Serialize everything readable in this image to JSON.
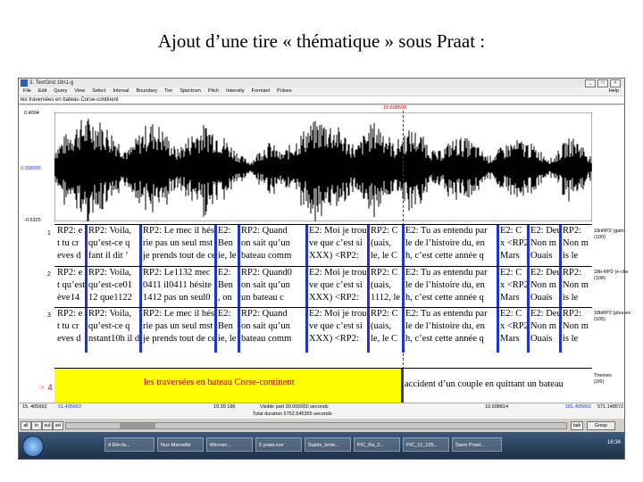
{
  "slide": {
    "title": "Ajout d’une tire « thématique » sous Praat :"
  },
  "window": {
    "title": "3. TextGrid 18n1-g",
    "controls": [
      "_",
      "□",
      "×"
    ],
    "menu": [
      "File",
      "Edit",
      "Query",
      "View",
      "Select",
      "Interval",
      "Boundary",
      "Tier",
      "Spectrum",
      "Pitch",
      "Intensity",
      "Formant",
      "Pulses"
    ],
    "help": "Help",
    "text_field": "les traversées en bateau Corse-continent"
  },
  "waveform": {
    "cursor_time": "10.608598",
    "y_top": "0.4004",
    "y_mid": "0.008306",
    "y_bottom": "-0.5325"
  },
  "tiers": [
    {
      "number": "1",
      "name": "18nRP2 (gam\n(100)",
      "intervals": [
        [
          "RP2: e\nt tu cr\neves d",
          "RP2: Voila,\nqu’est-ce q\nfant il dit ’",
          "RP2: Le mec il hés\nrie pas un seul mst\nje prends tout de ce",
          "E2:\nBen\nie, le",
          "RP2: Quand\non sait qu’un\nbateau comm",
          "E2: Moi je trou\nve que c’est si\nXXX) <RP2: ",
          "RP2: C\n(uais,\nle, le C",
          "E2: Tu as entendu par\nle de l’histoire du, en\nh, c’est cette année q",
          "E2: C\nx <RP2\nMars",
          "E2: Deu\nNon m\nOuais",
          "RP2:\nNon m\nis le"
        ]
      ]
    },
    {
      "number": "2",
      "name": "18b-RP2 (e-chv\n(108)",
      "intervals": [
        [
          "RP2: e\nt qu’est\nève14",
          "RP2: Voila,\nqu’est-ce01\n12 que1122",
          "RP2: Le1132 mec\n0411 il0411 hésite\n1412 pas un seul0",
          "E2:\nBen\n, on",
          "RP2: Quand0\non sait qu’un\nun bateau c",
          "E2: Moi je trou\nve que c’est si\nXXX) <RP2: ",
          "RP2: C\n(uais,\n1112, le",
          "E2: Tu as entendu par\nle de l’histoire du, en\nh, c’est cette année q",
          "E2: C\nx <RP2\nMars",
          "E2: Deu\nNon m\nOuais",
          "RP2:\nNon m\nis le"
        ]
      ]
    },
    {
      "number": "3",
      "name": "18bRP2 (plus-ex\n(105)",
      "intervals": [
        [
          "RP2: e\nt tu cr\neves d",
          "RP2: Voila,\nqu’est-ce q\nnstant10h il dt ’",
          "RP2: Le mec il hés\nrie pas un seul mst\nje prends tout de ce",
          "E2:\nBen\nie, le",
          "RP2: Quand\non sait qu’un\nbateau comm",
          "E2: Moi je trou\nve que c’est si\nXXX) <RP2: ",
          "RP2: C\n(uais,\nle, le C",
          "E2: Tu as entendu par\nle de l’histoire du, en\nh, c’est cette année q",
          "E2: C\nx <RP2\nMars",
          "E2: Deu\nNon m\nOuais",
          "RP2:\nNon m\nis le"
        ]
      ]
    }
  ],
  "theme_tier": {
    "number": "4",
    "name": "Themes\n(2/6)",
    "interval_1": "les traversées en bateau Corse-continent",
    "interval_2": "accident d’un couple en quittant un bateau"
  },
  "time": {
    "left_total": "15. 405662",
    "left_window": "51.405662",
    "mid_left": "19.39 186",
    "mid_right": "10.608814",
    "visible": "Visible part 30.000000 seconds",
    "right_window": "181.405662",
    "right_total": "571.148572",
    "total": "Total duration 5752.645355 seconds"
  },
  "controls": {
    "all": "all",
    "in": "in",
    "out": "out",
    "sel": "sel",
    "bak": "bak",
    "group": "Group"
  },
  "taskbar": {
    "items": [
      "4 Elin fa...",
      "Nuz-Marseille",
      "Microso...",
      "5 praat.exe",
      "Sujets_texte...",
      "PIC_Ra_2...",
      "PIC_12_225...",
      "Sarre Praat..."
    ],
    "clock": "16:34"
  },
  "colors": {
    "boundary": "#1f35c9",
    "theme_highlight": "#ffff00",
    "cursor": "#cc0000"
  }
}
